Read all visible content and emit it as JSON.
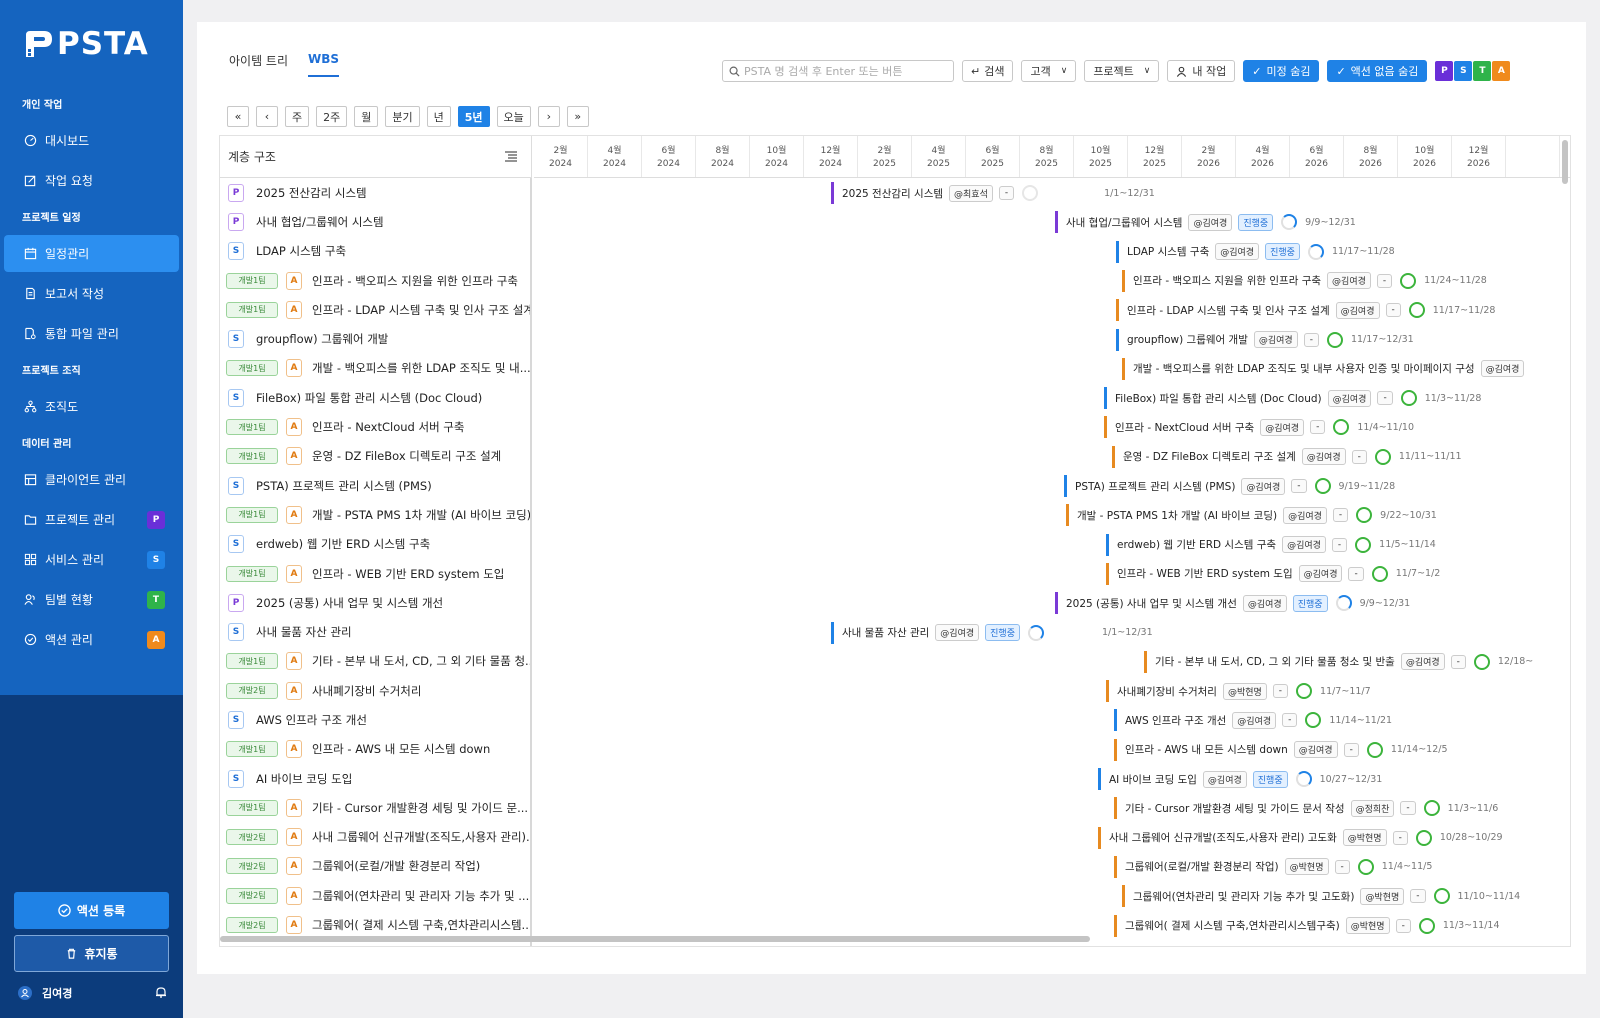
{
  "app": {
    "logo": "PSTA"
  },
  "sidebar": {
    "sections": [
      {
        "title": "개인 작업",
        "items": [
          {
            "label": "대시보드",
            "icon": "dashboard-icon"
          },
          {
            "label": "작업 요청",
            "icon": "edit-icon"
          }
        ]
      },
      {
        "title": "프로젝트 일정",
        "items": [
          {
            "label": "일정관리",
            "icon": "calendar-icon",
            "active": true
          },
          {
            "label": "보고서 작성",
            "icon": "document-icon"
          },
          {
            "label": "통합 파일 관리",
            "icon": "file-icon"
          }
        ]
      },
      {
        "title": "프로젝트 조직",
        "items": [
          {
            "label": "조직도",
            "icon": "org-chart-icon"
          }
        ]
      },
      {
        "title": "데이터 관리",
        "items": [
          {
            "label": "클라이언트 관리",
            "icon": "client-icon"
          },
          {
            "label": "프로젝트 관리",
            "icon": "folder-icon",
            "badge": "P",
            "badge_color": "#6a2fd8"
          },
          {
            "label": "서비스 관리",
            "icon": "grid-icon",
            "badge": "S",
            "badge_color": "#1f82e6"
          },
          {
            "label": "팀별 현황",
            "icon": "team-icon",
            "badge": "T",
            "badge_color": "#2fb34a"
          },
          {
            "label": "액션 관리",
            "icon": "check-circle-icon",
            "badge": "A",
            "badge_color": "#f08a1c"
          }
        ]
      }
    ],
    "register_label": "액션 등록",
    "trash_label": "휴지통",
    "user_name": "김여경"
  },
  "tabs": [
    {
      "label": "아이템 트리",
      "active": false
    },
    {
      "label": "WBS",
      "active": true
    }
  ],
  "toolbar": {
    "search_placeholder": "PSTA 명 검색 후 Enter 또는 버튼",
    "search_label": "검색",
    "client_label": "고객",
    "project_label": "프로젝트",
    "my_work_label": "내 작업",
    "hide_unset_label": "미정 숨김",
    "hide_no_action_label": "액션 없음 숨김",
    "type_filters": [
      {
        "label": "P",
        "color": "#6a2fd8"
      },
      {
        "label": "S",
        "color": "#1f82e6"
      },
      {
        "label": "T",
        "color": "#2fb34a"
      },
      {
        "label": "A",
        "color": "#f08a1c"
      }
    ]
  },
  "range_buttons": [
    "«",
    "‹",
    "주",
    "2주",
    "월",
    "분기",
    "년",
    "5년",
    "오늘",
    "›",
    "»"
  ],
  "range_active": "5년",
  "tree_header": "계층 구조",
  "timeline_months": [
    {
      "m": "2월",
      "y": "2024"
    },
    {
      "m": "4월",
      "y": "2024"
    },
    {
      "m": "6월",
      "y": "2024"
    },
    {
      "m": "8월",
      "y": "2024"
    },
    {
      "m": "10월",
      "y": "2024"
    },
    {
      "m": "12월",
      "y": "2024"
    },
    {
      "m": "2월",
      "y": "2025"
    },
    {
      "m": "4월",
      "y": "2025"
    },
    {
      "m": "6월",
      "y": "2025"
    },
    {
      "m": "8월",
      "y": "2025"
    },
    {
      "m": "10월",
      "y": "2025"
    },
    {
      "m": "12월",
      "y": "2025"
    },
    {
      "m": "2월",
      "y": "2026"
    },
    {
      "m": "4월",
      "y": "2026"
    },
    {
      "m": "6월",
      "y": "2026"
    },
    {
      "m": "8월",
      "y": "2026"
    },
    {
      "m": "10월",
      "y": "2026"
    },
    {
      "m": "12월",
      "y": "2026"
    },
    {
      "m": "",
      "y": ""
    }
  ],
  "rows": [
    {
      "type": "P",
      "dev": "",
      "label": "2025 전산감리 시스템",
      "bar_label": "2025 전산감리 시스템",
      "owner": "@최효석",
      "status": "-",
      "progress": "none",
      "dates": "1/1~12/31"
    },
    {
      "type": "P",
      "dev": "",
      "label": "사내 협업/그룹웨어 시스템",
      "bar_label": "사내 협업/그룹웨어 시스템",
      "owner": "@김여경",
      "status": "진행중",
      "progress": "prog",
      "dates": "9/9~12/31"
    },
    {
      "type": "S",
      "dev": "",
      "label": "LDAP 시스템 구축",
      "bar_label": "LDAP 시스템 구축",
      "owner": "@김여경",
      "status": "진행중",
      "progress": "prog",
      "dates": "11/17~11/28"
    },
    {
      "type": "A",
      "dev": "개발1팀",
      "label": "인프라 - 백오피스 지원을 위한 인프라 구축",
      "bar_label": "인프라 - 백오피스 지원을 위한 인프라 구축",
      "owner": "@김여경",
      "status": "-",
      "progress": "done",
      "dates": "11/24~11/28"
    },
    {
      "type": "A",
      "dev": "개발1팀",
      "label": "인프라 - LDAP 시스템 구축 및 인사 구조 설계",
      "bar_label": "인프라 - LDAP 시스템 구축 및 인사 구조 설계",
      "owner": "@김여경",
      "status": "-",
      "progress": "done",
      "dates": "11/17~11/28"
    },
    {
      "type": "S",
      "dev": "",
      "label": "groupflow) 그룹웨어 개발",
      "bar_label": "groupflow) 그룹웨어 개발",
      "owner": "@김여경",
      "status": "-",
      "progress": "done",
      "dates": "11/17~12/31"
    },
    {
      "type": "A",
      "dev": "개발1팀",
      "label": "개발 - 백오피스를 위한 LDAP 조직도 및 내...",
      "bar_label": "개발 - 백오피스를 위한 LDAP 조직도 및 내부 사용자 인증 및 마이페이지 구성",
      "owner": "@김여경",
      "status": "",
      "progress": "",
      "dates": ""
    },
    {
      "type": "S",
      "dev": "",
      "label": "FileBox) 파일 통합 관리 시스템 (Doc Cloud)",
      "bar_label": "FileBox) 파일 통합 관리 시스템 (Doc Cloud)",
      "owner": "@김여경",
      "status": "-",
      "progress": "done",
      "dates": "11/3~11/28"
    },
    {
      "type": "A",
      "dev": "개발1팀",
      "label": "인프라 - NextCloud 서버 구축",
      "bar_label": "인프라 - NextCloud 서버 구축",
      "owner": "@김여경",
      "status": "-",
      "progress": "done",
      "dates": "11/4~11/10"
    },
    {
      "type": "A",
      "dev": "개발1팀",
      "label": "운영 - DZ FileBox 디렉토리 구조 설계",
      "bar_label": "운영 - DZ FileBox 디렉토리 구조 설계",
      "owner": "@김여경",
      "status": "-",
      "progress": "done",
      "dates": "11/11~11/11"
    },
    {
      "type": "S",
      "dev": "",
      "label": "PSTA) 프로젝트 관리 시스템 (PMS)",
      "bar_label": "PSTA) 프로젝트 관리 시스템 (PMS)",
      "owner": "@김여경",
      "status": "-",
      "progress": "done",
      "dates": "9/19~11/28"
    },
    {
      "type": "A",
      "dev": "개발1팀",
      "label": "개발 - PSTA PMS 1차 개발 (AI 바이브 코딩)",
      "bar_label": "개발 - PSTA PMS 1차 개발 (AI 바이브 코딩)",
      "owner": "@김여경",
      "status": "-",
      "progress": "done",
      "dates": "9/22~10/31"
    },
    {
      "type": "S",
      "dev": "",
      "label": "erdweb) 웹 기반 ERD 시스템 구축",
      "bar_label": "erdweb) 웹 기반 ERD 시스템 구축",
      "owner": "@김여경",
      "status": "-",
      "progress": "done",
      "dates": "11/5~11/14"
    },
    {
      "type": "A",
      "dev": "개발1팀",
      "label": "인프라 - WEB 기반 ERD system 도입",
      "bar_label": "인프라 - WEB 기반 ERD system 도입",
      "owner": "@김여경",
      "status": "-",
      "progress": "done",
      "dates": "11/7~1/2"
    },
    {
      "type": "P",
      "dev": "",
      "label": "2025 (공통) 사내 업무 및 시스템 개선",
      "bar_label": "2025 (공통) 사내 업무 및 시스템 개선",
      "owner": "@김여경",
      "status": "진행중",
      "progress": "prog",
      "dates": "9/9~12/31"
    },
    {
      "type": "S",
      "dev": "",
      "label": "사내 물품 자산 관리",
      "bar_label": "사내 물품 자산 관리",
      "owner": "@김여경",
      "status": "진행중",
      "progress": "prog",
      "dates": "1/1~12/31"
    },
    {
      "type": "A",
      "dev": "개발1팀",
      "label": "기타 - 본부 내 도서, CD, 그 외 기타 물품 청...",
      "bar_label": "기타 - 본부 내 도서, CD, 그 외 기타 물품 청소 및 반출",
      "owner": "@김여경",
      "status": "-",
      "progress": "done",
      "dates": "12/18~"
    },
    {
      "type": "A",
      "dev": "개발2팀",
      "label": "사내폐기장비 수거처리",
      "bar_label": "사내폐기장비 수거처리",
      "owner": "@박현명",
      "status": "-",
      "progress": "done",
      "dates": "11/7~11/7"
    },
    {
      "type": "S",
      "dev": "",
      "label": "AWS 인프라 구조 개선",
      "bar_label": "AWS 인프라 구조 개선",
      "owner": "@김여경",
      "status": "-",
      "progress": "done",
      "dates": "11/14~11/21"
    },
    {
      "type": "A",
      "dev": "개발1팀",
      "label": "인프라 - AWS 내 모든 시스템 down",
      "bar_label": "인프라 - AWS 내 모든 시스템 down",
      "owner": "@김여경",
      "status": "-",
      "progress": "done",
      "dates": "11/14~12/5"
    },
    {
      "type": "S",
      "dev": "",
      "label": "AI 바이브 코딩 도입",
      "bar_label": "AI 바이브 코딩 도입",
      "owner": "@김여경",
      "status": "진행중",
      "progress": "prog",
      "dates": "10/27~12/31"
    },
    {
      "type": "A",
      "dev": "개발1팀",
      "label": "기타 - Cursor 개발환경 세팅 및 가이드 문...",
      "bar_label": "기타 - Cursor 개발환경 세팅 및 가이드 문서 작성",
      "owner": "@정희찬",
      "status": "-",
      "progress": "done",
      "dates": "11/3~11/6"
    },
    {
      "type": "A",
      "dev": "개발2팀",
      "label": "사내 그룹웨어 신규개발(조직도,사용자 관리)...",
      "bar_label": "사내 그룹웨어 신규개발(조직도,사용자 관리) 고도화",
      "owner": "@박현명",
      "status": "-",
      "progress": "done",
      "dates": "10/28~10/29"
    },
    {
      "type": "A",
      "dev": "개발2팀",
      "label": "그룹웨어(로컬/개발 환경분리 작업)",
      "bar_label": "그룹웨어(로컬/개발 환경분리 작업)",
      "owner": "@박현명",
      "status": "-",
      "progress": "done",
      "dates": "11/4~11/5"
    },
    {
      "type": "A",
      "dev": "개발2팀",
      "label": "그룹웨어(연차관리 및 관리자 기능 추가 및 ...",
      "bar_label": "그룹웨어(연차관리 및 관리자 기능 추가 및 고도화)",
      "owner": "@박현명",
      "status": "-",
      "progress": "done",
      "dates": "11/10~11/14"
    },
    {
      "type": "A",
      "dev": "개발2팀",
      "label": "그룹웨어( 결제 시스템 구축,연차관리시스템...",
      "bar_label": "그룹웨어( 결제 시스템 구축,연차관리시스템구축)",
      "owner": "@박현명",
      "status": "-",
      "progress": "done",
      "dates": "11/3~11/14"
    }
  ]
}
